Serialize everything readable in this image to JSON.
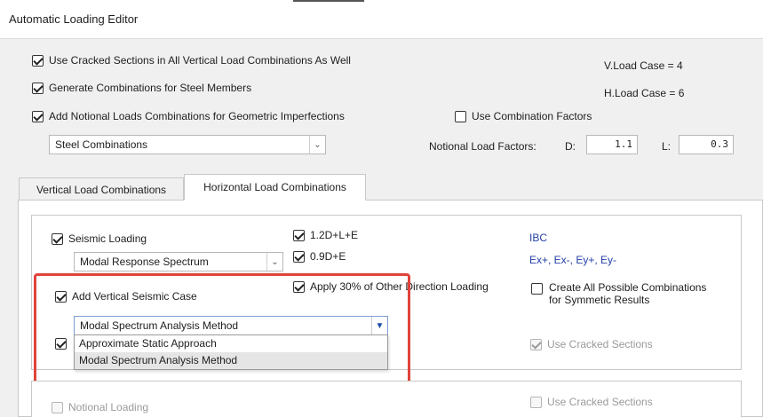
{
  "window": {
    "title": "Automatic Loading Editor"
  },
  "top_options": {
    "cracked_sections": "Use Cracked Sections in All Vertical Load Combinations As Well",
    "steel_members": "Generate Combinations for Steel Members",
    "notional_loads": "Add Notional Loads Combinations for Geometric Imperfections",
    "use_combination_factors": "Use Combination Factors",
    "v_load_case": "V.Load Case = 4",
    "h_load_case": "H.Load Case = 6",
    "combination_select": "Steel Combinations",
    "notional_factors_label": "Notional Load Factors:",
    "d_label": "D:",
    "d_value": "1.1",
    "l_label": "L:",
    "l_value": "0.3"
  },
  "tabs": [
    {
      "label": "Vertical Load Combinations"
    },
    {
      "label": "Horizontal Load Combinations"
    }
  ],
  "seismic": {
    "seismic_loading": "Seismic Loading",
    "method_select": "Modal Response Spectrum",
    "combo1": "1.2D+L+E",
    "combo2": "0.9D+E",
    "apply_30": "Apply 30% of Other Direction Loading",
    "code": "IBC",
    "cases": "Ex+, Ex-, Ey+, Ey-",
    "create_all": "Create All Possible Combinations",
    "create_all_2": "for Symmetic Results",
    "add_vertical": "Add Vertical Seismic Case",
    "vertical_select": "Modal Spectrum Analysis Method",
    "dropdown_options": [
      "Approximate Static Approach",
      "Modal Spectrum Analysis Method"
    ],
    "use_cracked_1": "Use Cracked Sections"
  },
  "notional": {
    "notional_loading": "Notional Loading",
    "use_cracked_2": "Use Cracked Sections"
  }
}
